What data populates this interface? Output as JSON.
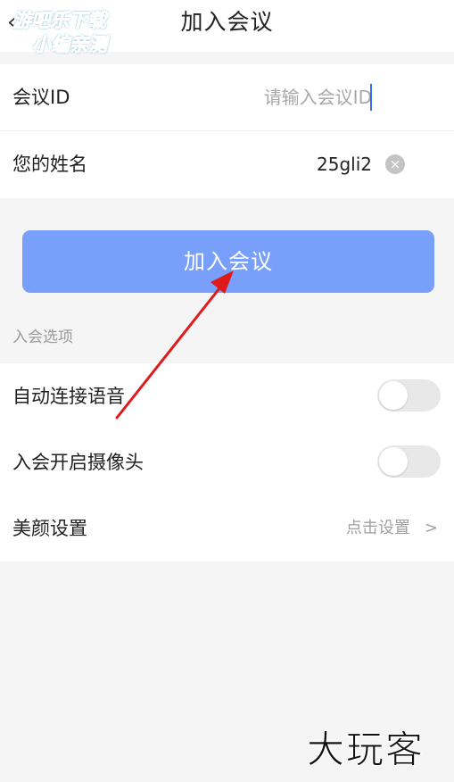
{
  "header": {
    "back_icon": "chevron-left",
    "title": "加入会议"
  },
  "watermark_top": {
    "line1": "游吧乐下载",
    "line2": "小编亲测"
  },
  "form": {
    "meeting_id": {
      "label": "会议ID",
      "value": "",
      "placeholder": "请输入会议ID"
    },
    "name": {
      "label": "您的姓名",
      "value": "25gli2",
      "clear_icon": "clear-x"
    }
  },
  "join_button": {
    "label": "加入会议",
    "color": "#789ffa"
  },
  "options": {
    "section_title": "入会选项",
    "auto_audio": {
      "label": "自动连接语音",
      "enabled": false
    },
    "camera_on": {
      "label": "入会开启摄像头",
      "enabled": false
    },
    "beauty": {
      "label": "美颜设置",
      "action": "点击设置",
      "arrow": ">"
    }
  },
  "annotation": {
    "color": "#e0191b"
  },
  "watermark_bottom": "大玩客"
}
